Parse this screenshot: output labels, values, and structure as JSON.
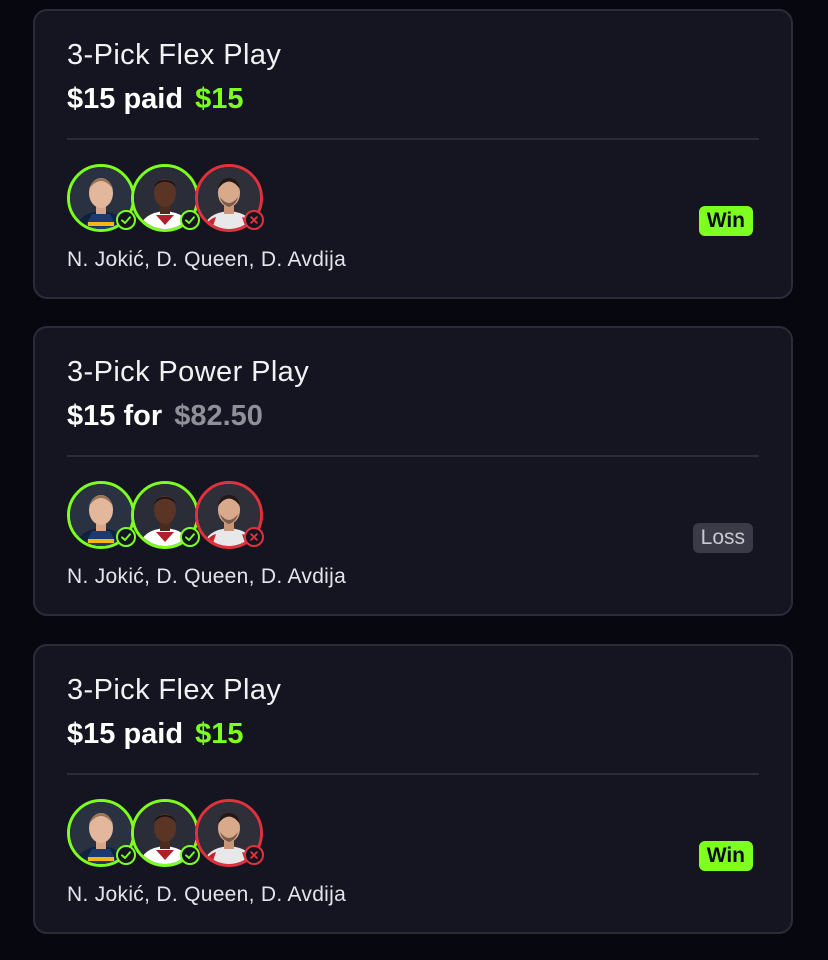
{
  "colors": {
    "background": "#070710",
    "card": "#141520",
    "win_green": "#7dff1f",
    "loss_red": "#e0323d",
    "muted_payout": "#8e8f99"
  },
  "entries": [
    {
      "title": "3-Pick Flex Play",
      "stake": "$15",
      "connector": "paid",
      "payout": "$15",
      "payout_state": "win",
      "players": "N. Jokić, D. Queen, D. Avdija",
      "pick_status": [
        "check-icon",
        "check-icon",
        "x-icon"
      ],
      "result": "Win"
    },
    {
      "title": "3-Pick Power Play",
      "stake": "$15",
      "connector": "for",
      "payout": "$82.50",
      "payout_state": "loss",
      "players": "N. Jokić, D. Queen, D. Avdija",
      "pick_status": [
        "check-icon",
        "check-icon",
        "x-icon"
      ],
      "result": "Loss"
    },
    {
      "title": "3-Pick Flex Play",
      "stake": "$15",
      "connector": "paid",
      "payout": "$15",
      "payout_state": "win",
      "players": "N. Jokić, D. Queen, D. Avdija",
      "pick_status": [
        "check-icon",
        "check-icon",
        "x-icon"
      ],
      "result": "Win"
    }
  ]
}
